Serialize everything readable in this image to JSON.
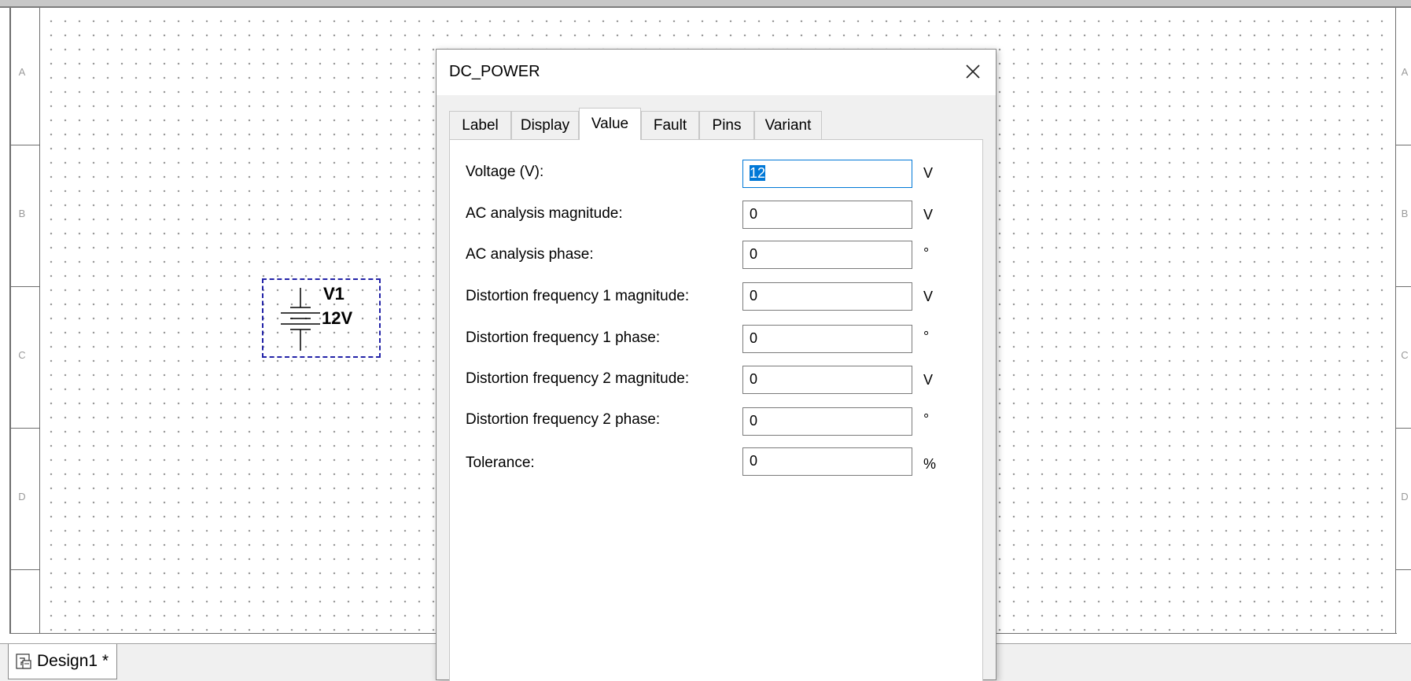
{
  "workspace": {
    "zones_left": [
      "A",
      "B",
      "C",
      "D"
    ],
    "zones_right": [
      "A",
      "B",
      "C",
      "D"
    ],
    "component": {
      "ref": "V1",
      "value": "12V"
    }
  },
  "dialog": {
    "title": "DC_POWER",
    "close_glyph": "✕",
    "tabs": [
      {
        "label": "Label",
        "active": false
      },
      {
        "label": "Display",
        "active": false
      },
      {
        "label": "Value",
        "active": true
      },
      {
        "label": "Fault",
        "active": false
      },
      {
        "label": "Pins",
        "active": false
      },
      {
        "label": "Variant",
        "active": false
      }
    ],
    "fields": [
      {
        "label": "Voltage (V):",
        "value": "12",
        "unit": "V"
      },
      {
        "label": "AC analysis magnitude:",
        "value": "0",
        "unit": "V"
      },
      {
        "label": "AC analysis phase:",
        "value": "0",
        "unit": "°"
      },
      {
        "label": "Distortion frequency 1 magnitude:",
        "value": "0",
        "unit": "V"
      },
      {
        "label": "Distortion frequency 1 phase:",
        "value": "0",
        "unit": "°"
      },
      {
        "label": "Distortion frequency 2 magnitude:",
        "value": "0",
        "unit": "V"
      },
      {
        "label": "Distortion frequency 2 phase:",
        "value": "0",
        "unit": "°"
      },
      {
        "label": "Tolerance:",
        "value": "0",
        "unit": "%"
      }
    ]
  },
  "tabbar": {
    "design_tab": "Design1 *"
  },
  "colors": {
    "selection": "#0078d7",
    "component_border": "#2323a8"
  }
}
